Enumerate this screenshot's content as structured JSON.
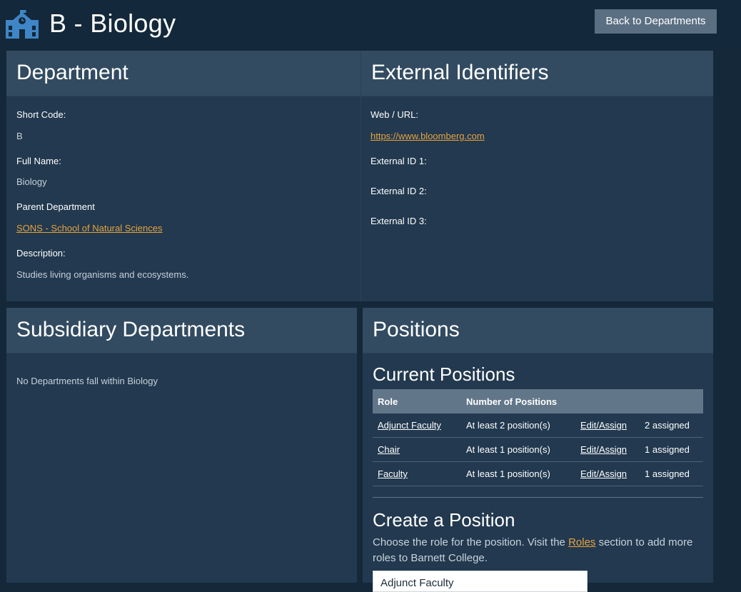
{
  "header": {
    "title": "B - Biology",
    "back_button": "Back to Departments",
    "icon": "school-building-icon"
  },
  "department": {
    "heading": "Department",
    "short_code_label": "Short Code:",
    "short_code": "B",
    "full_name_label": "Full Name:",
    "full_name": "Biology",
    "parent_label": "Parent Department",
    "parent_value": "SONS - School of Natural Sciences",
    "description_label": "Description:",
    "description": "Studies living organisms and ecosystems."
  },
  "external": {
    "heading": "External Identifiers",
    "url_label": "Web / URL:",
    "url": "https://www.bloomberg.com",
    "id1_label": "External ID 1:",
    "id2_label": "External ID 2:",
    "id3_label": "External ID 3:"
  },
  "subsidiary": {
    "heading": "Subsidiary Departments",
    "empty_text": "No Departments fall within Biology"
  },
  "positions": {
    "heading": "Positions",
    "current_heading": "Current Positions",
    "columns": [
      "Role",
      "Number of Positions",
      "",
      ""
    ],
    "rows": [
      {
        "role": "Adjunct Faculty",
        "count": "At least 2 position(s)",
        "action": "Edit/Assign",
        "assigned": "2 assigned"
      },
      {
        "role": "Chair",
        "count": "At least 1 position(s)",
        "action": "Edit/Assign",
        "assigned": "1 assigned"
      },
      {
        "role": "Faculty",
        "count": "At least 1 position(s)",
        "action": "Edit/Assign",
        "assigned": "1 assigned"
      }
    ],
    "create_heading": "Create a Position",
    "help_before": "Choose the role for the position. Visit the ",
    "help_link": "Roles",
    "help_after": " section to add more roles to Barnett College.",
    "select_value": "Adjunct Faculty"
  },
  "colors": {
    "background": "#142839",
    "card": "#22394f",
    "card_header": "#324b61",
    "link_accent": "#e8a33d",
    "button": "#5b6f82",
    "icon": "#3f86c6"
  }
}
